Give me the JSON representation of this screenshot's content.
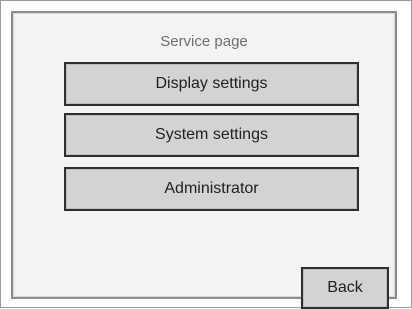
{
  "page": {
    "title": "Service page"
  },
  "menu": {
    "display_settings_label": "Display settings",
    "system_settings_label": "System settings",
    "administrator_label": "Administrator"
  },
  "footer": {
    "back_label": "Back"
  },
  "colors": {
    "button_fill": "#d3d3d3",
    "button_border": "#2e2e2e",
    "screen_background": "#f3f3f3",
    "title_text": "#6f6f6f"
  }
}
